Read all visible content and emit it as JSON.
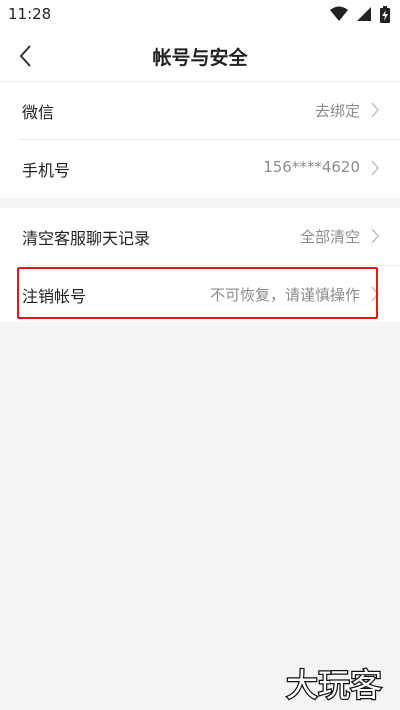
{
  "status_bar": {
    "time": "11:28",
    "icons": [
      "wifi-icon",
      "signal-icon",
      "battery-charging-icon"
    ]
  },
  "header": {
    "title": "帐号与安全",
    "back_icon": "chevron-left-icon"
  },
  "sections": [
    {
      "rows": [
        {
          "label": "微信",
          "value": "去绑定"
        },
        {
          "label": "手机号",
          "value": "156****4620"
        }
      ]
    },
    {
      "rows": [
        {
          "label": "清空客服聊天记录",
          "value": "全部清空"
        },
        {
          "label": "注销帐号",
          "value": "不可恢复，请谨慎操作"
        }
      ]
    }
  ],
  "highlight": {
    "color": "#e4161b",
    "target": "注销帐号"
  },
  "watermark": {
    "text": "大玩客"
  },
  "colors": {
    "background": "#f4f4f4",
    "card": "#ffffff",
    "label": "#222222",
    "secondary": "#8c8c8c",
    "highlight": "#e4161b"
  }
}
